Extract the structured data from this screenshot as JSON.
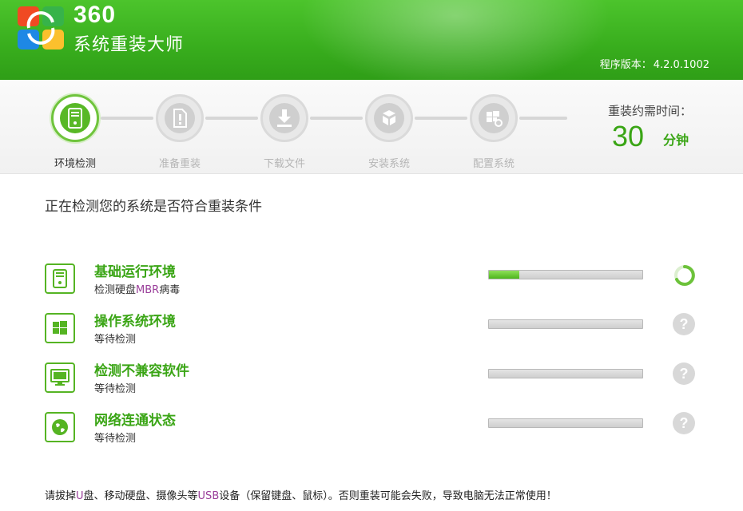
{
  "header": {
    "brand_number": "360",
    "brand_name": "系统重装大师",
    "version_label": "程序版本：",
    "version_value": "4.2.0.1002"
  },
  "steps": [
    {
      "label": "环境检测",
      "active": true,
      "icon": "computer-icon"
    },
    {
      "label": "准备重装",
      "active": false,
      "icon": "document-icon"
    },
    {
      "label": "下载文件",
      "active": false,
      "icon": "download-icon"
    },
    {
      "label": "安装系统",
      "active": false,
      "icon": "boxes-icon"
    },
    {
      "label": "配置系统",
      "active": false,
      "icon": "settings-windows-icon"
    }
  ],
  "time": {
    "title": "重装约需时间：",
    "value": "30",
    "unit": "分钟"
  },
  "main": {
    "title": "正在检测您的系统是否符合重装条件"
  },
  "checks": [
    {
      "title": "基础运行环境",
      "sub_pre": "检测硬盘",
      "sub_hl": "MBR",
      "sub_post": "病毒",
      "progress": 0.2,
      "status": "loading",
      "icon": "computer-icon"
    },
    {
      "title": "操作系统环境",
      "sub_pre": "等待检测",
      "sub_hl": "",
      "sub_post": "",
      "progress": 0,
      "status": "pending",
      "icon": "windows-icon"
    },
    {
      "title": "检测不兼容软件",
      "sub_pre": "等待检测",
      "sub_hl": "",
      "sub_post": "",
      "progress": 0,
      "status": "pending",
      "icon": "monitor-icon"
    },
    {
      "title": "网络连通状态",
      "sub_pre": "等待检测",
      "sub_hl": "",
      "sub_post": "",
      "progress": 0,
      "status": "pending",
      "icon": "globe-icon"
    }
  ],
  "status_pending_symbol": "?",
  "footer": {
    "p1": "请拔掉",
    "h1": "U",
    "p2": "盘、移动硬盘、摄像头等",
    "h2": "USB",
    "p3": "设备（保留键盘、鼠标）。否则重装可能会失败，导致电脑无法正常使用！"
  },
  "colors": {
    "brand_green": "#3aa515",
    "header_green": "#38ad1d",
    "highlight_purple": "#9a3f9a"
  }
}
